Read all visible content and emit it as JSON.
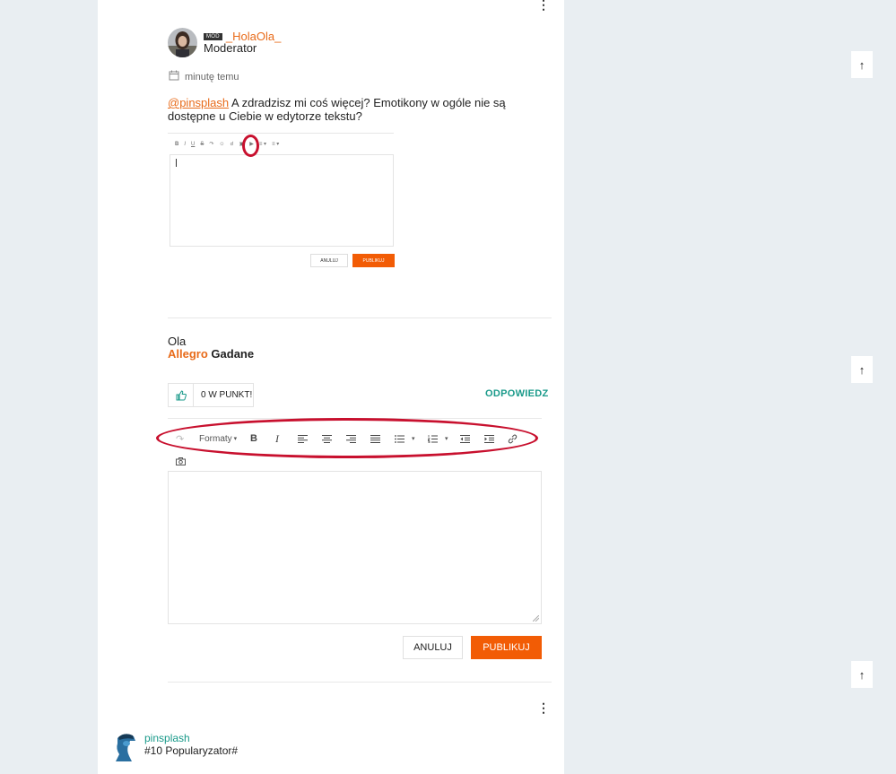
{
  "post": {
    "author": "_HolaOla_",
    "badge": "MOD",
    "role": "Moderator",
    "time": "minutę temu",
    "mention": "@pinsplash",
    "text": " A zdradzisz mi coś więcej? Emotikony w ogóle nie są dostępne u Ciebie w edytorze tekstu?",
    "embedded_screenshot": {
      "toolbar_icons": [
        "bold-icon",
        "italic-icon",
        "underline-icon",
        "strikethrough-icon",
        "redo-icon",
        "emoji-icon",
        "link-icon",
        "image-icon",
        "video-icon",
        "bullet-list-icon",
        "numbered-list-icon"
      ],
      "cancel_label": "ANULUJ",
      "publish_label": "PUBLIKUJ"
    },
    "signature": {
      "name": "Ola",
      "brand": "Allegro",
      "rest": " Gadane"
    },
    "vote_label": "0 W PUNKT!",
    "reply_label": "ODPOWIEDZ"
  },
  "editor": {
    "toolbar": {
      "formats_label": "Formaty",
      "icons": [
        "redo-icon",
        "bold-icon",
        "italic-icon",
        "align-left-icon",
        "align-center-icon",
        "align-right-icon",
        "align-justify-icon",
        "bullet-list-icon",
        "numbered-list-icon",
        "outdent-icon",
        "indent-icon",
        "link-icon",
        "camera-icon"
      ]
    },
    "value": "",
    "cancel_label": "ANULUJ",
    "publish_label": "PUBLIKUJ"
  },
  "next_post": {
    "author": "pinsplash",
    "rank": "#10 Popularyzator#"
  },
  "colors": {
    "accent_orange": "#f25c05",
    "username_orange": "#e86b1a",
    "teal": "#1a9a8a",
    "annotation_red": "#c8102e",
    "page_bg": "#e9eef2"
  }
}
